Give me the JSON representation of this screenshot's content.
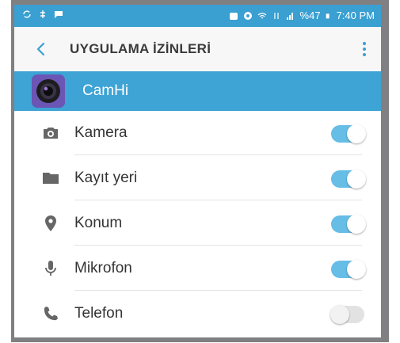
{
  "statusbar": {
    "battery": "%47",
    "time": "7:40 PM"
  },
  "toolbar": {
    "title": "UYGULAMA İZİNLERİ"
  },
  "app": {
    "name": "CamHi"
  },
  "permissions": [
    {
      "label": "Kamera",
      "icon": "camera-icon",
      "enabled": true
    },
    {
      "label": "Kayıt yeri",
      "icon": "folder-icon",
      "enabled": true
    },
    {
      "label": "Konum",
      "icon": "location-icon",
      "enabled": true
    },
    {
      "label": "Mikrofon",
      "icon": "microphone-icon",
      "enabled": true
    },
    {
      "label": "Telefon",
      "icon": "phone-icon",
      "enabled": false
    }
  ],
  "colors": {
    "statusbar": "#3a9fd1",
    "appbar": "#3ea3d5",
    "toggle_on": "#66bde6",
    "toggle_off": "#e2e2e2",
    "accent_back": "#3a9fd1"
  }
}
